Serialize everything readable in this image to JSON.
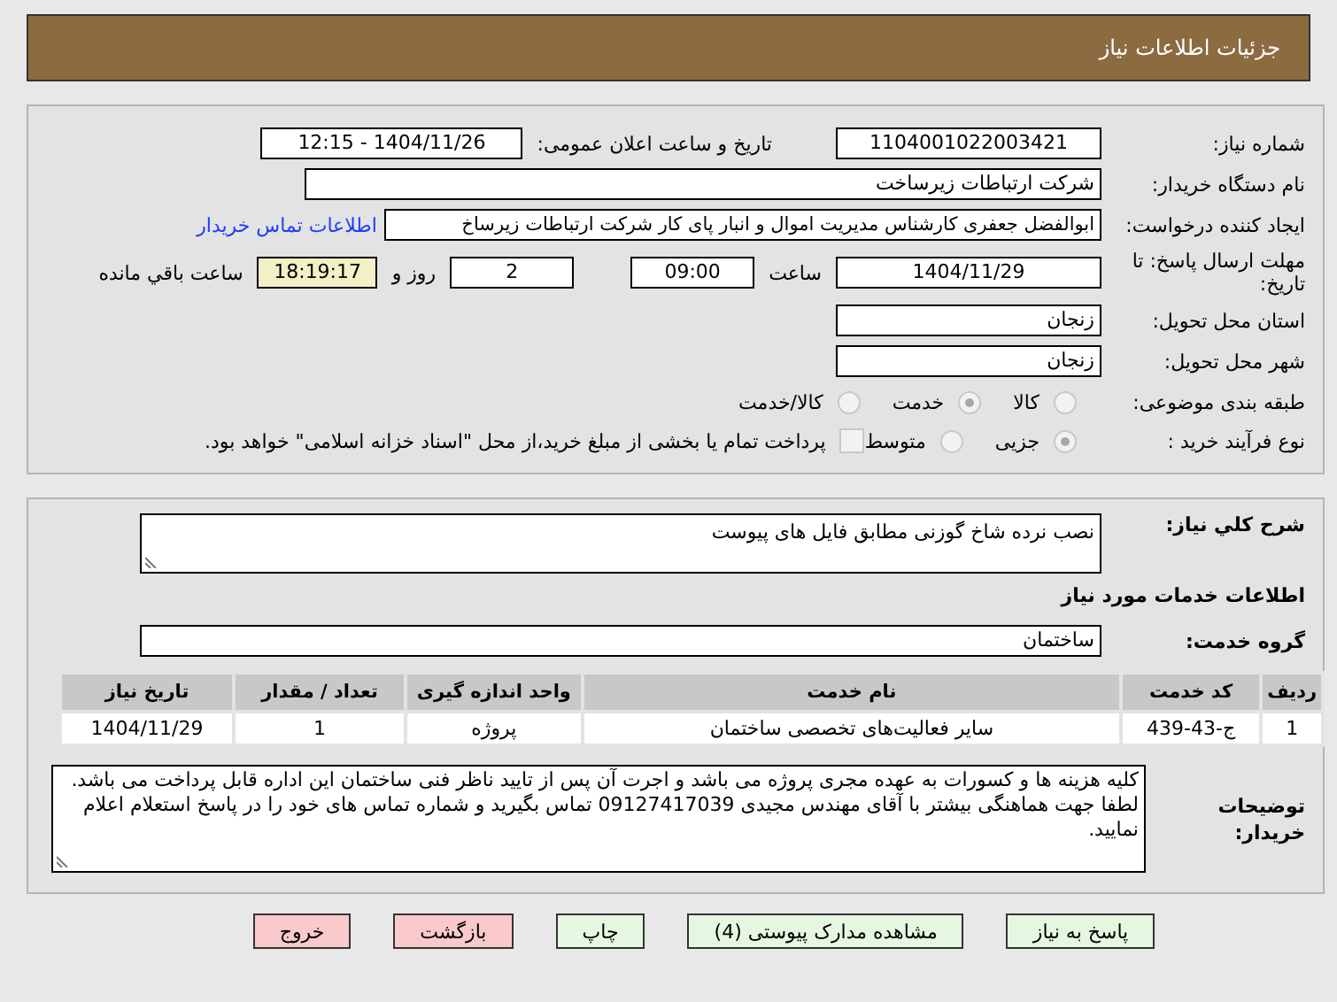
{
  "header": {
    "title": "جزئیات اطلاعات نیاز"
  },
  "need_number": {
    "label": "شماره نیاز:",
    "value": "1104001022003421"
  },
  "announce": {
    "label": "تاریخ و ساعت اعلان عمومی:",
    "value": "1404/11/26 - 12:15"
  },
  "buyer": {
    "label": "نام دستگاه خریدار:",
    "value": "شرکت ارتباطات زیرساخت"
  },
  "requester": {
    "label": "ایجاد کننده درخواست:",
    "value": "ابوالفضل جعفری کارشناس مدیریت اموال و انبار پای کار  شرکت ارتباطات زیرساخ",
    "link": "اطلاعات تماس خریدار"
  },
  "deadline": {
    "label": "مهلت ارسال پاسخ: تا تاریخ:",
    "date": "1404/11/29",
    "time_label": "ساعت",
    "time": "09:00",
    "days": "2",
    "days_label": "روز و",
    "remaining": "18:19:17",
    "remaining_label": "ساعت باقي مانده"
  },
  "province": {
    "label": "استان محل تحویل:",
    "value": "زنجان"
  },
  "city": {
    "label": "شهر محل تحویل:",
    "value": "زنجان"
  },
  "category": {
    "label": "طبقه بندی موضوعی:",
    "options": [
      {
        "label": "کالا",
        "selected": false
      },
      {
        "label": "خدمت",
        "selected": true
      },
      {
        "label": "کالا/خدمت",
        "selected": false
      }
    ]
  },
  "process": {
    "label": "نوع فرآیند خرید :",
    "options": [
      {
        "label": "جزیی",
        "selected": true
      },
      {
        "label": "متوسط",
        "selected": false
      }
    ],
    "payment": {
      "checked": false,
      "text": "پرداخت تمام یا بخشی از مبلغ خرید،از محل \"اسناد خزانه اسلامی\" خواهد بود."
    }
  },
  "description": {
    "label": "شرح کلي نیاز:",
    "value": "نصب نرده شاخ گوزنی مطابق فایل های پیوست"
  },
  "services_title": "اطلاعات خدمات مورد نیاز",
  "service_group": {
    "label": "گروه خدمت:",
    "value": "ساختمان"
  },
  "table": {
    "columns": [
      "ردیف",
      "کد خدمت",
      "نام خدمت",
      "واحد اندازه گیری",
      "تعداد / مقدار",
      "تاریخ نیاز"
    ],
    "rows": [
      [
        "1",
        "ج-43-439",
        "سایر فعالیت‌های تخصصی ساختمان",
        "پروژه",
        "1",
        "1404/11/29"
      ]
    ]
  },
  "notes": {
    "label": "توضیحات خریدار:",
    "value": "کلیه هزینه ها و کسورات به عهده مجری پروژه می باشد و اجرت آن پس از تایید ناظر فنی ساختمان این اداره قابل پرداخت می باشد.\nلطفا جهت هماهنگی بیشتر با آقای مهندس مجیدی 09127417039 تماس بگیرید و شماره تماس های خود را در پاسخ استعلام اعلام نمایید."
  },
  "buttons": [
    {
      "label": "پاسخ به نیاز",
      "kind": "action"
    },
    {
      "label": "مشاهده مدارک پیوستی (4)",
      "kind": "action"
    },
    {
      "label": "چاپ",
      "kind": "action"
    },
    {
      "label": "بازگشت",
      "kind": "exit"
    },
    {
      "label": "خروج",
      "kind": "exit"
    }
  ]
}
